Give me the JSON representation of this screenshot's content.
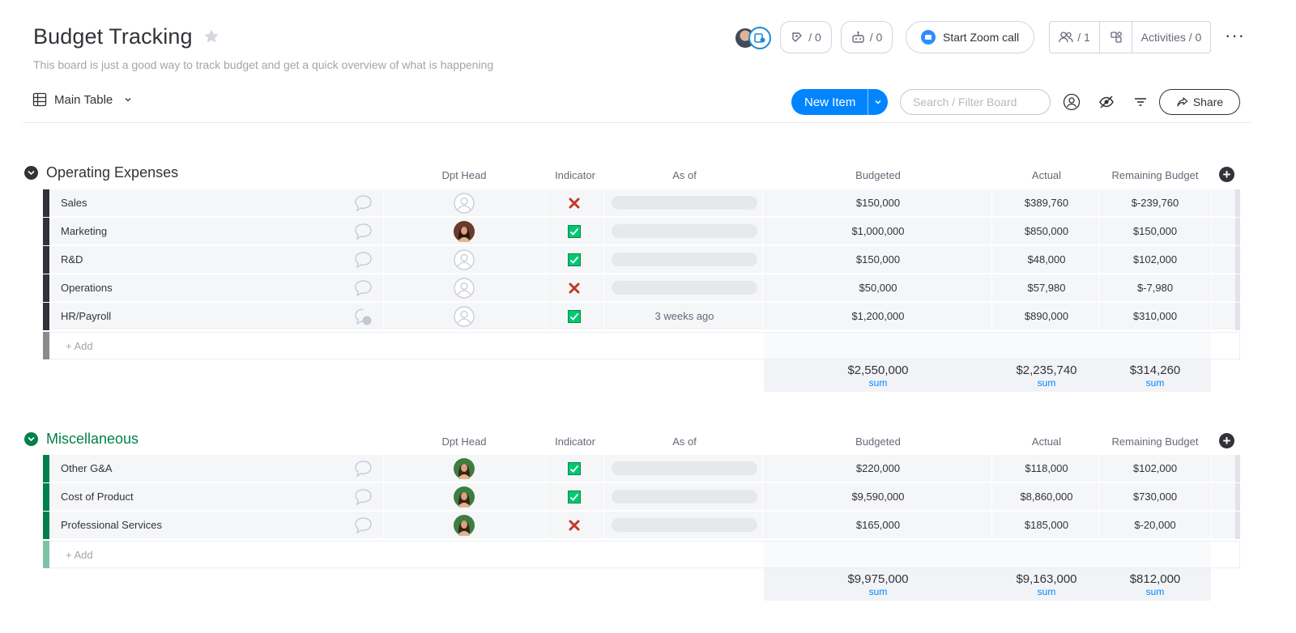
{
  "board": {
    "title": "Budget Tracking",
    "description": "This board is just a good way to track budget and get a quick overview of what is happening"
  },
  "header": {
    "updates_count": "/ 0",
    "automations_count": "/ 0",
    "zoom_label": "Start Zoom call",
    "members_count": "/ 1",
    "activities_label": "Activities / 0",
    "more_label": "···"
  },
  "toolbar": {
    "view_label": "Main Table",
    "new_item_label": "New Item",
    "search_placeholder": "Search / Filter Board",
    "share_label": "Share"
  },
  "columns": {
    "dpt_head": "Dpt Head",
    "indicator": "Indicator",
    "as_of": "As of",
    "budgeted": "Budgeted",
    "actual": "Actual",
    "remaining": "Remaining Budget"
  },
  "add_label": "+ Add",
  "sum_label": "sum",
  "colors": {
    "primary": "#0085ff",
    "group1": "#323338",
    "group2": "#037f4c",
    "indicator_ok": "#00c875",
    "indicator_bad": "#c0392b"
  },
  "groups": [
    {
      "title": "Operating Expenses",
      "rows": [
        {
          "name": "Sales",
          "head": "empty",
          "indicator": "x",
          "as_of": "",
          "budgeted": "$150,000",
          "actual": "$389,760",
          "remaining": "$-239,760",
          "updates": ""
        },
        {
          "name": "Marketing",
          "head": "woman-dark",
          "indicator": "check",
          "as_of": "",
          "budgeted": "$1,000,000",
          "actual": "$850,000",
          "remaining": "$150,000",
          "updates": ""
        },
        {
          "name": "R&D",
          "head": "empty",
          "indicator": "check",
          "as_of": "",
          "budgeted": "$150,000",
          "actual": "$48,000",
          "remaining": "$102,000",
          "updates": ""
        },
        {
          "name": "Operations",
          "head": "empty",
          "indicator": "x",
          "as_of": "",
          "budgeted": "$50,000",
          "actual": "$57,980",
          "remaining": "$-7,980",
          "updates": ""
        },
        {
          "name": "HR/Payroll",
          "head": "empty",
          "indicator": "check",
          "as_of": "3 weeks ago",
          "budgeted": "$1,200,000",
          "actual": "$890,000",
          "remaining": "$310,000",
          "updates": "1"
        }
      ],
      "sums": {
        "budgeted": "$2,550,000",
        "actual": "$2,235,740",
        "remaining": "$314,260"
      }
    },
    {
      "title": "Miscellaneous",
      "rows": [
        {
          "name": "Other G&A",
          "head": "woman-green",
          "indicator": "check",
          "as_of": "",
          "budgeted": "$220,000",
          "actual": "$118,000",
          "remaining": "$102,000",
          "updates": ""
        },
        {
          "name": "Cost of Product",
          "head": "woman-green",
          "indicator": "check",
          "as_of": "",
          "budgeted": "$9,590,000",
          "actual": "$8,860,000",
          "remaining": "$730,000",
          "updates": ""
        },
        {
          "name": "Professional Services",
          "head": "woman-green",
          "indicator": "x",
          "as_of": "",
          "budgeted": "$165,000",
          "actual": "$185,000",
          "remaining": "$-20,000",
          "updates": ""
        }
      ],
      "sums": {
        "budgeted": "$9,975,000",
        "actual": "$9,163,000",
        "remaining": "$812,000"
      }
    }
  ]
}
